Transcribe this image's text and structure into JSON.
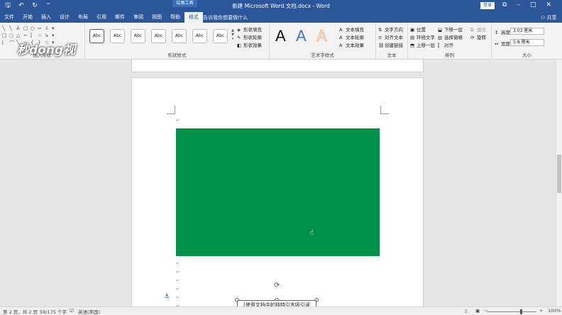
{
  "title_bar": {
    "document_title": "新建 Microsoft Word 文档.docx - Word",
    "context_label": "绘图工具",
    "login_label": "登录"
  },
  "tabs": [
    "文件",
    "开始",
    "插入",
    "设计",
    "布局",
    "引用",
    "邮件",
    "审阅",
    "视图",
    "帮助",
    "格式"
  ],
  "active_tab": "格式",
  "tell_me": "告诉我你想要做什么",
  "share_label": "共享",
  "watermark": "秒dong视频",
  "ribbon": {
    "insert_shapes": {
      "label": "插入形状"
    },
    "shape_styles": {
      "label": "形状样式",
      "style_label": "Abc",
      "fill": "形状填充",
      "outline": "形状轮廓",
      "effects": "形状效果"
    },
    "wordart": {
      "label": "艺术字样式",
      "sample": "A",
      "text_fill": "文本填充",
      "text_outline": "文本轮廓",
      "text_effects": "文本效果"
    },
    "text": {
      "label": "文本",
      "direction": "文字方向",
      "align": "对齐文本",
      "link": "创建链接"
    },
    "arrange": {
      "label": "排列",
      "position": "位置",
      "wrap": "环绕文字",
      "bring_forward": "上移一层",
      "send_backward": "下移一层",
      "selection_pane": "选择窗格",
      "align": "对齐",
      "group": "组合",
      "rotate": "旋转"
    },
    "size": {
      "label": "大小",
      "height_label": "高度:",
      "height_value": "3.03 厘米",
      "width_label": "宽度:",
      "width_value": "5.8 厘米"
    }
  },
  "document": {
    "textbox_text": "[使用文档中的独特引言吸引读",
    "shape_color": "#009149"
  },
  "status_bar": {
    "page": "第 2 页，共 2 页",
    "words": "59/175 个字",
    "language": "英语(美国)",
    "zoom": "100%"
  },
  "colors": {
    "brand": "#2b579a",
    "wordart_blue": "#4472c4",
    "wordart_orange": "#f4b183"
  }
}
